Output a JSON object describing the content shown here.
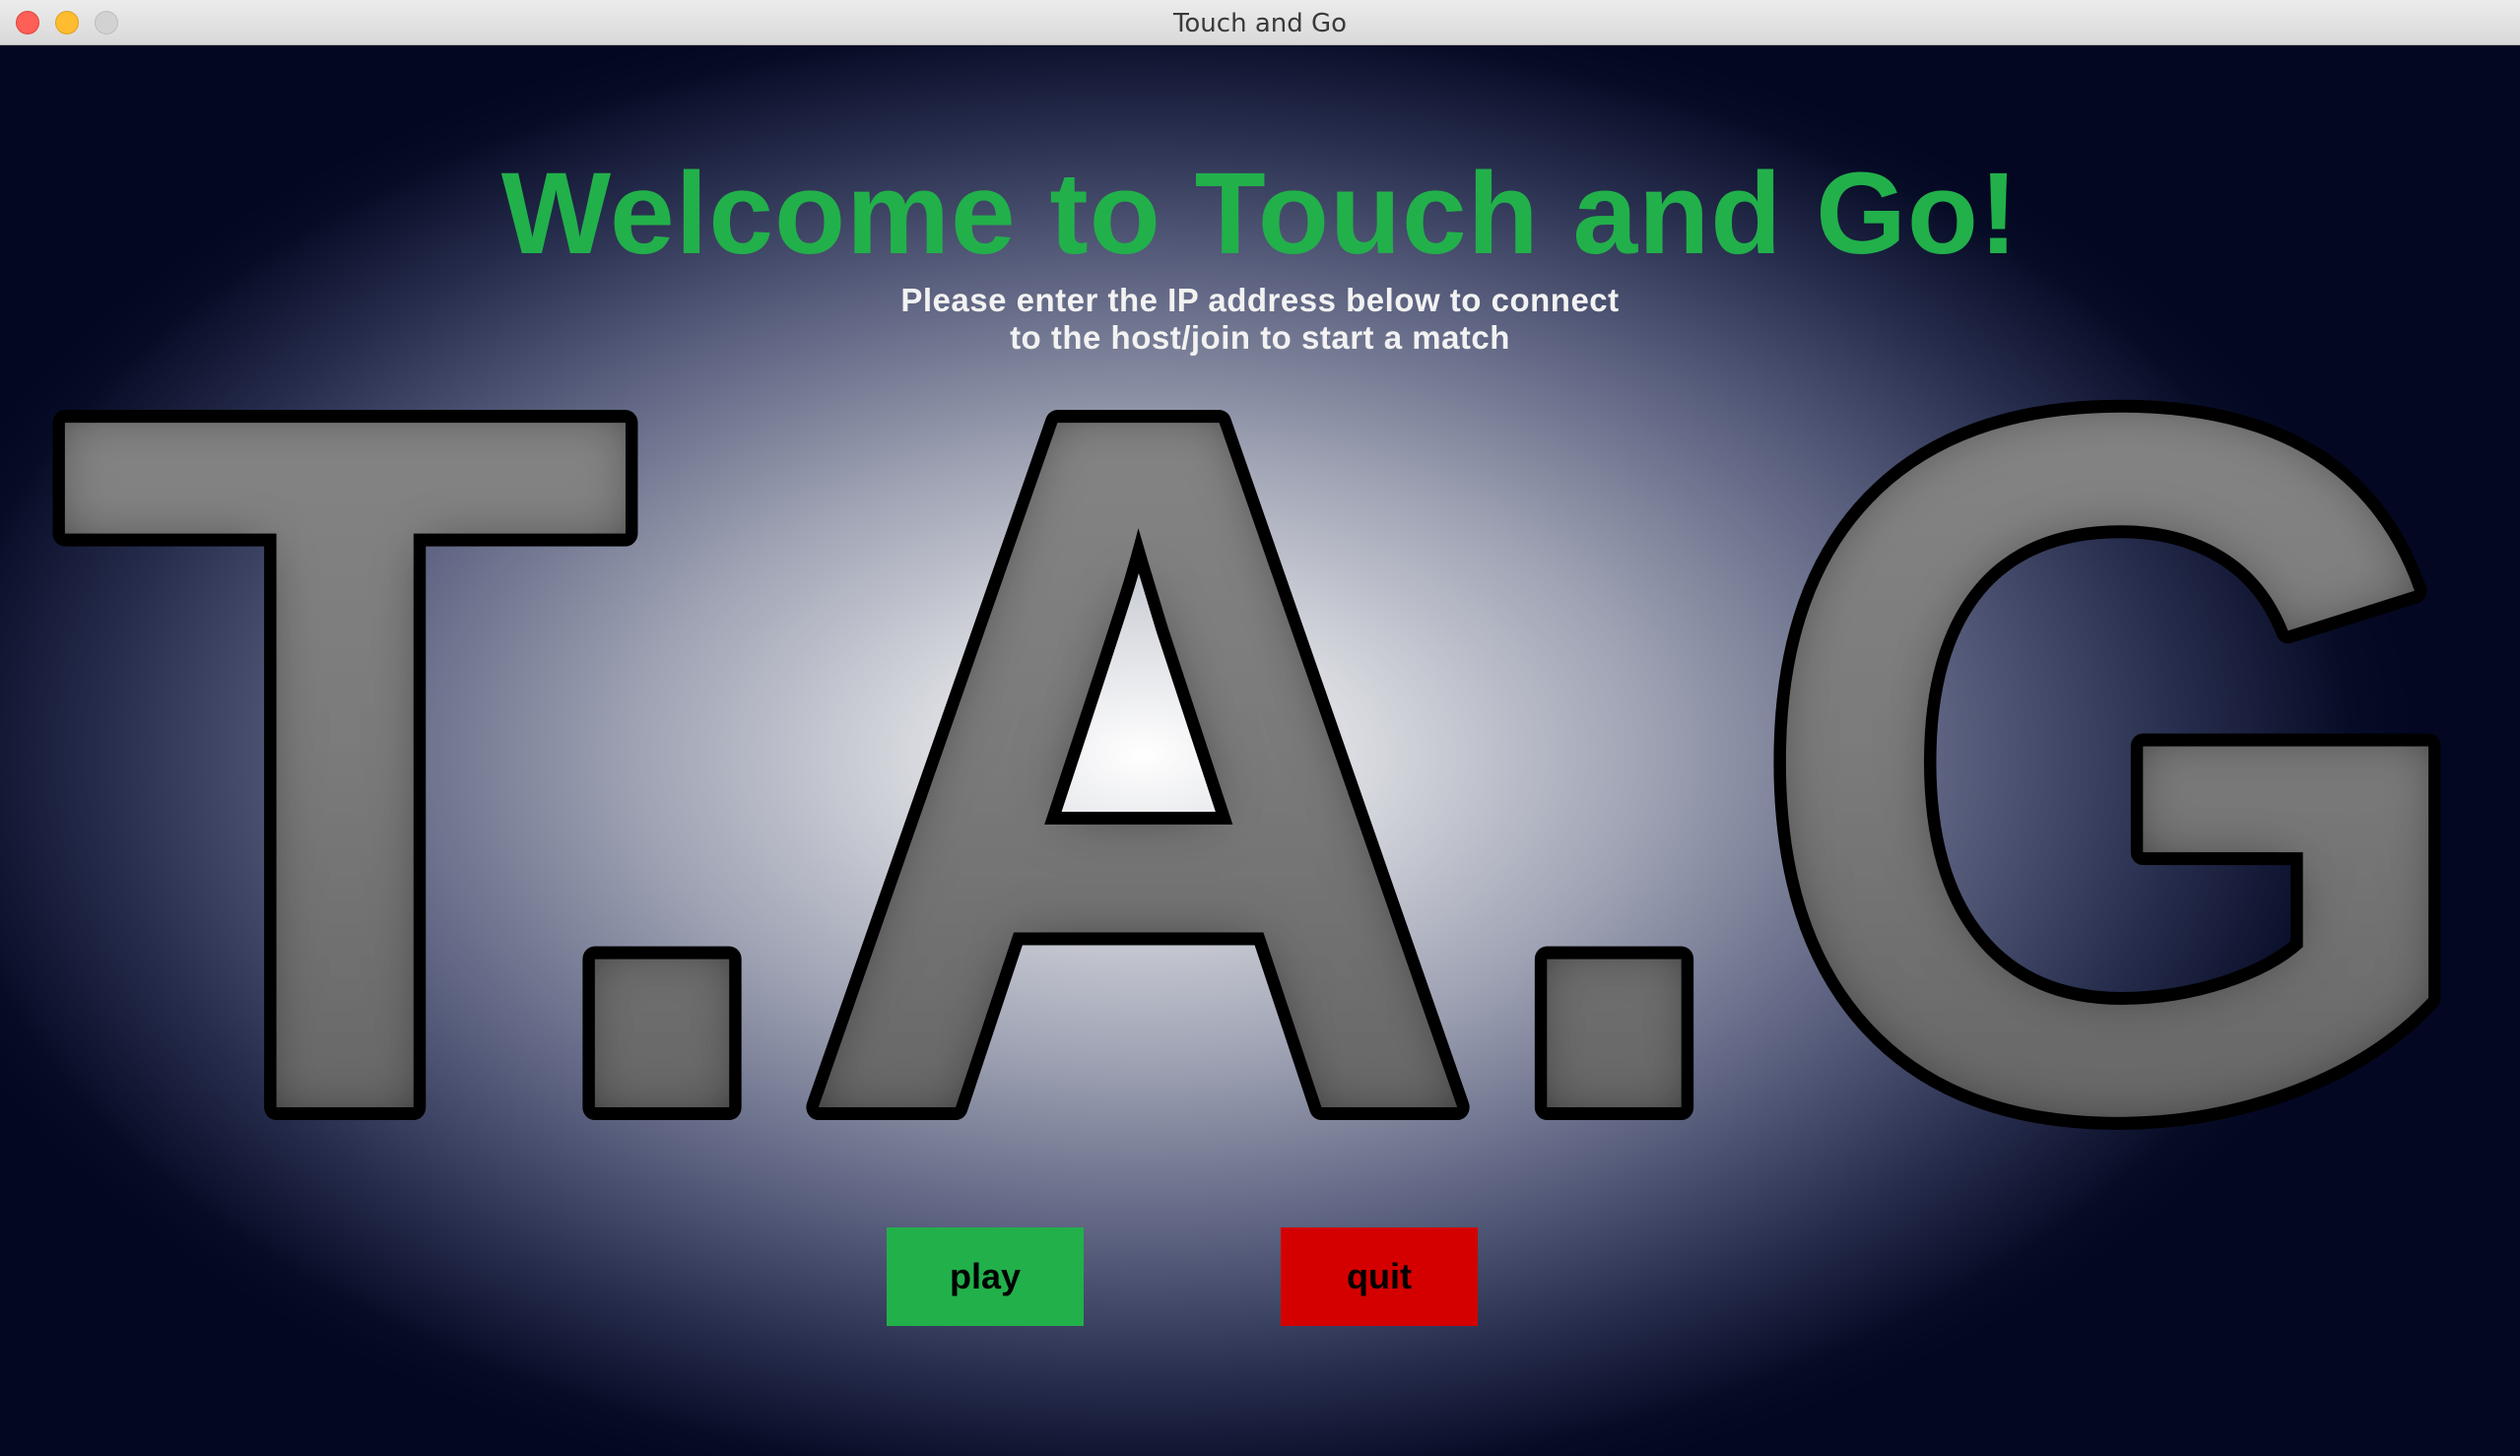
{
  "window": {
    "title": "Touch and Go"
  },
  "main": {
    "heading": "Welcome to Touch and Go!",
    "instructions": [
      "Please enter the IP address below to connect",
      "to the host/join to start a match"
    ],
    "logo_text": "T.A.G"
  },
  "buttons": {
    "play_label": "play",
    "quit_label": "quit"
  },
  "colors": {
    "heading": "#22b04b",
    "play_button": "#22b04b",
    "quit_button": "#d40000",
    "background_dark": "#030721",
    "logo_outline": "#000000",
    "logo_fill": "#6f6f6f"
  },
  "icons": [
    "close-icon",
    "minimize-icon",
    "maximize-icon"
  ]
}
